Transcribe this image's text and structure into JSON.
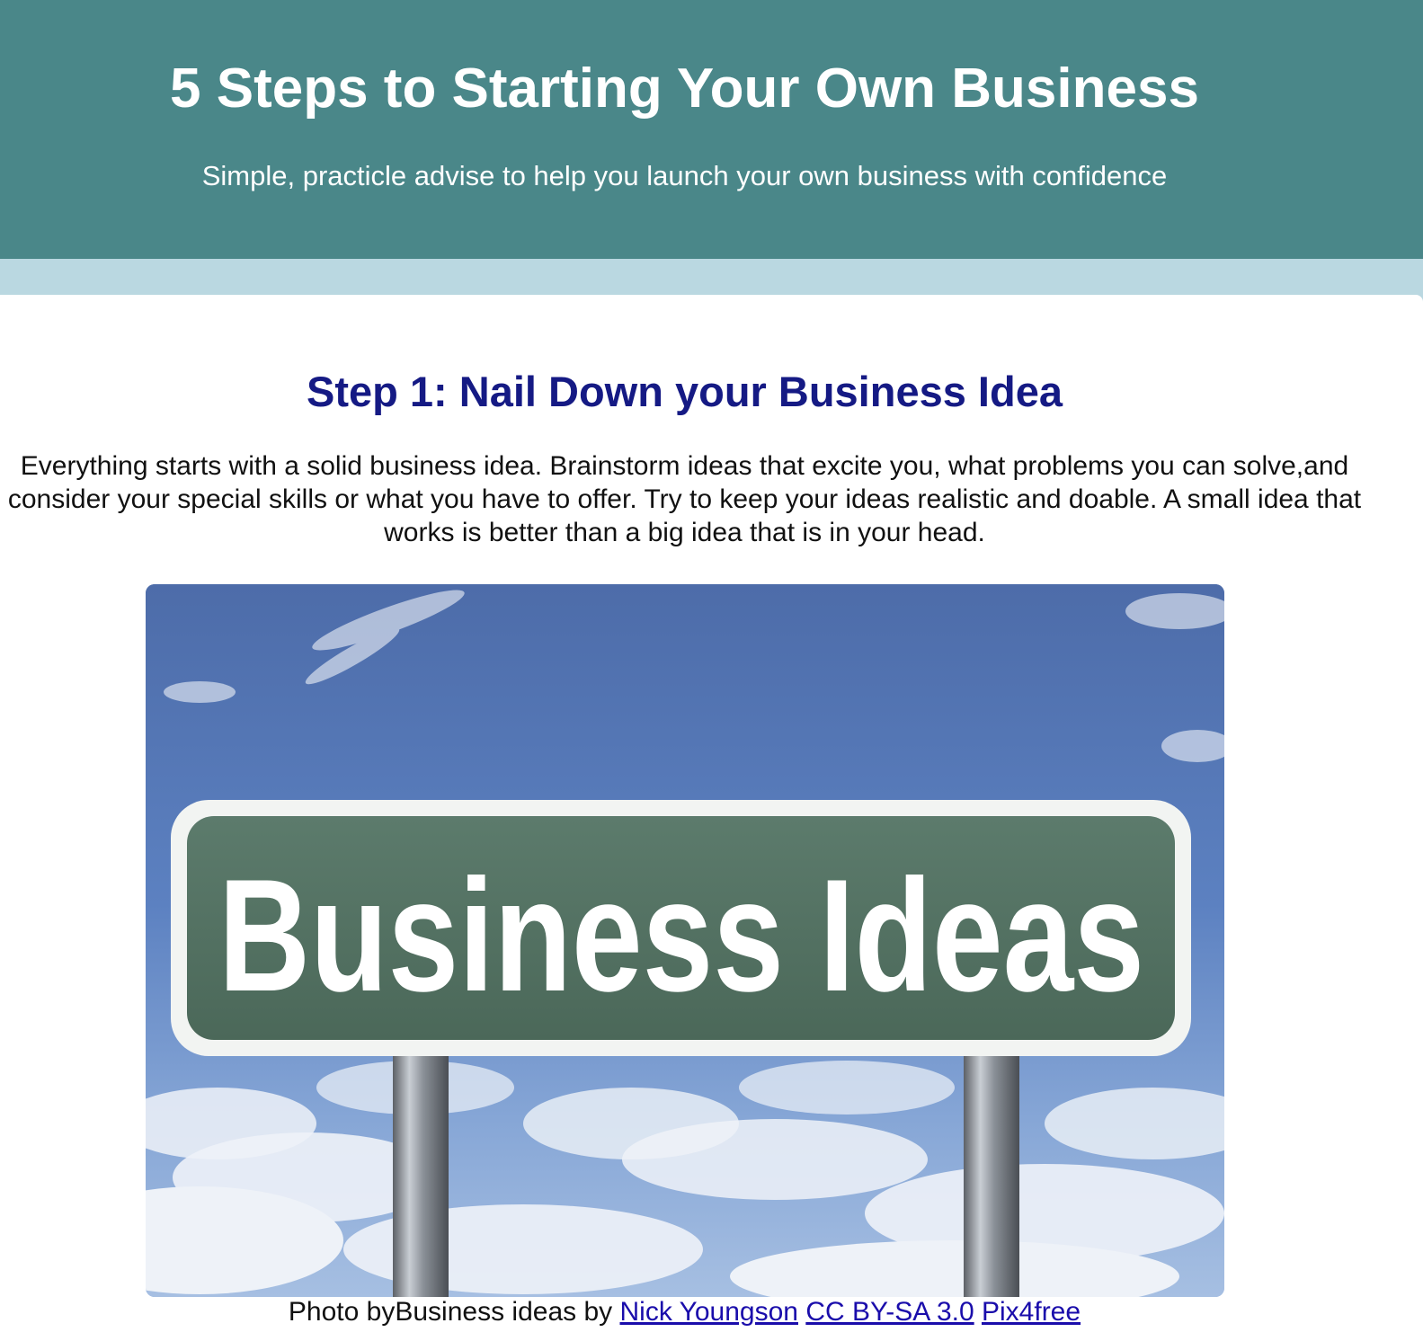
{
  "header": {
    "title": "5 Steps to Starting Your Own Business",
    "subtitle": "Simple, practicle advise to help you launch your own business with confidence"
  },
  "step1": {
    "heading": "Step 1: Nail Down your Business Idea",
    "paragraph": "Everything starts with a solid business idea. Brainstorm ideas that excite you, what problems you can solve,and consider your special skills or what you have to offer. Try to keep your ideas realistic and doable. A small idea that works is better than a big idea that is in your head.",
    "image": {
      "sign_text": "Business Ideas"
    },
    "caption": {
      "prefix": "Photo byBusiness ideas by ",
      "author_link": "Nick Youngson",
      "license_link": "CC BY-SA 3.0",
      "source_link": "Pix4free"
    }
  },
  "colors": {
    "header_bg": "#4a8789",
    "band_bg": "#bad8e1",
    "heading": "#151a84",
    "link": "#1a0dab"
  }
}
